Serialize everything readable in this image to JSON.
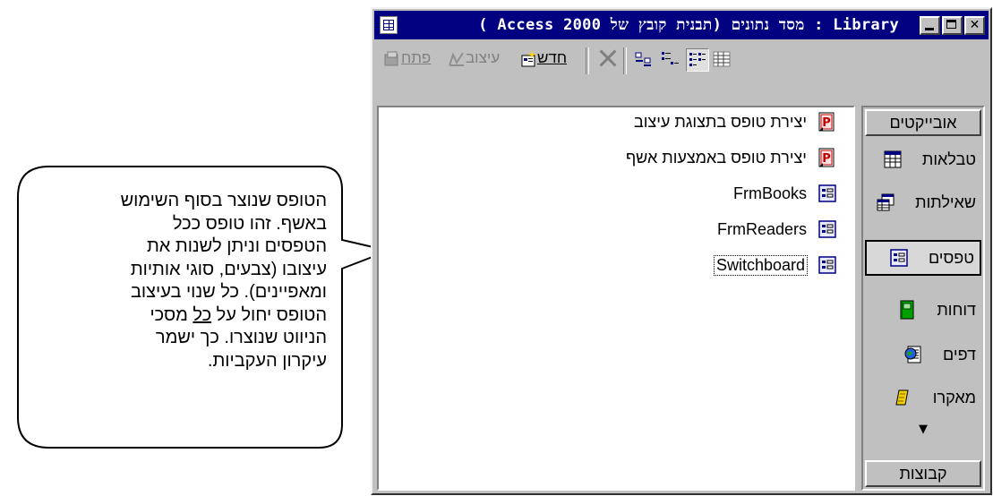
{
  "window": {
    "title": "( Access 2000 מסד נתונים (תבנית קובץ של : Library"
  },
  "toolbar": {
    "open_label": "פתח",
    "design_label": "עיצוב",
    "new_label": "חדש"
  },
  "objects_bar": {
    "header": "אובייקטים",
    "items": [
      {
        "label": "טבלאות",
        "icon": "table-icon"
      },
      {
        "label": "שאילתות",
        "icon": "query-icon"
      },
      {
        "label": "טפסים",
        "icon": "form-icon",
        "selected": true
      },
      {
        "label": "דוחות",
        "icon": "report-icon"
      },
      {
        "label": "דפים",
        "icon": "page-icon"
      },
      {
        "label": "מאקרו",
        "icon": "macro-icon"
      }
    ],
    "more": "▼",
    "groups": "קבוצות"
  },
  "forms_list": {
    "items": [
      {
        "label": "יצירת טופס בתצוגת עיצוב",
        "icon": "wizard-shortcut-icon"
      },
      {
        "label": "יצירת טופס באמצעות אשף",
        "icon": "wizard-shortcut-icon"
      },
      {
        "label": "FrmBooks",
        "icon": "form-icon"
      },
      {
        "label": "FrmReaders",
        "icon": "form-icon"
      },
      {
        "label": "Switchboard",
        "icon": "form-icon",
        "selected": true
      }
    ]
  },
  "callout": {
    "line1": "הטופס שנוצר בסוף השימוש",
    "line2": "באשף. זהו טופס ככל",
    "line3": "הטפסים וניתן לשנות את",
    "line4": "עיצובו (צבעים, סוגי אותיות",
    "line5": "ומאפיינים). כל שנוי בעיצוב",
    "line6_a": "הטופס יחול על ",
    "line6_u": "כל",
    "line6_b": " מסכי",
    "line7": "הניווט שנוצרו. כך ישמר",
    "line8": "עיקרון העקביות."
  }
}
